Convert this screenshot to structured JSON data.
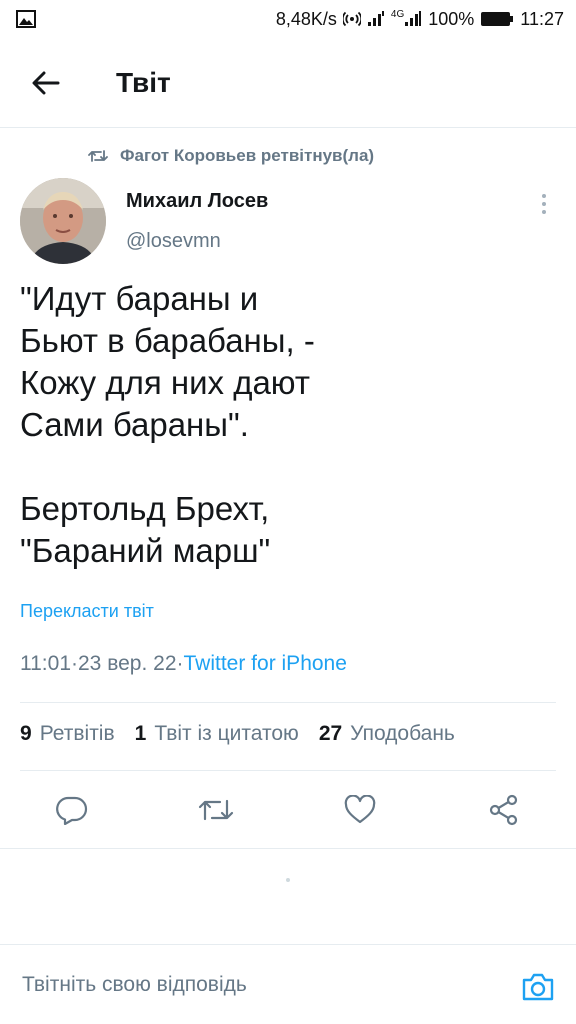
{
  "status_bar": {
    "speed": "8,48K/s",
    "network": "4G",
    "battery": "100%",
    "time": "11:27",
    "icons": [
      "image-icon",
      "hotspot-icon",
      "signal-icon",
      "battery-icon"
    ]
  },
  "header": {
    "title": "Твіт",
    "back_icon": "arrow-left-icon"
  },
  "retweet": {
    "text": "Фагот Коровьев ретвітнув(ла)",
    "icon": "retweet-icon"
  },
  "author": {
    "name": "Михаил Лосев",
    "handle": "@losevmn"
  },
  "tweet": {
    "lines": [
      "\"Идут бараны и",
      "Бьют в барабаны, -",
      "Кожу для них дают",
      "Сами бараны\".",
      "",
      "Бертольд Брехт,",
      "\"Бараний марш\""
    ],
    "translate": "Перекласти твіт"
  },
  "meta": {
    "time": "11:01",
    "date": "23 вер. 22",
    "separator": " · ",
    "source": "Twitter for iPhone"
  },
  "stats": {
    "retweets_count": "9",
    "retweets_label": "Ретвітів",
    "quotes_count": "1",
    "quotes_label": "Твіт із цитатою",
    "likes_count": "27",
    "likes_label": "Уподобань"
  },
  "actions": [
    "reply-icon",
    "retweet-icon",
    "like-icon",
    "share-icon"
  ],
  "reply_bar": {
    "placeholder": "Твітніть свою відповідь",
    "camera_icon": "camera-icon"
  },
  "colors": {
    "accent": "#1da1f2",
    "secondary_text": "#657786",
    "primary_text": "#14171a",
    "divider": "#e6ecf0"
  }
}
